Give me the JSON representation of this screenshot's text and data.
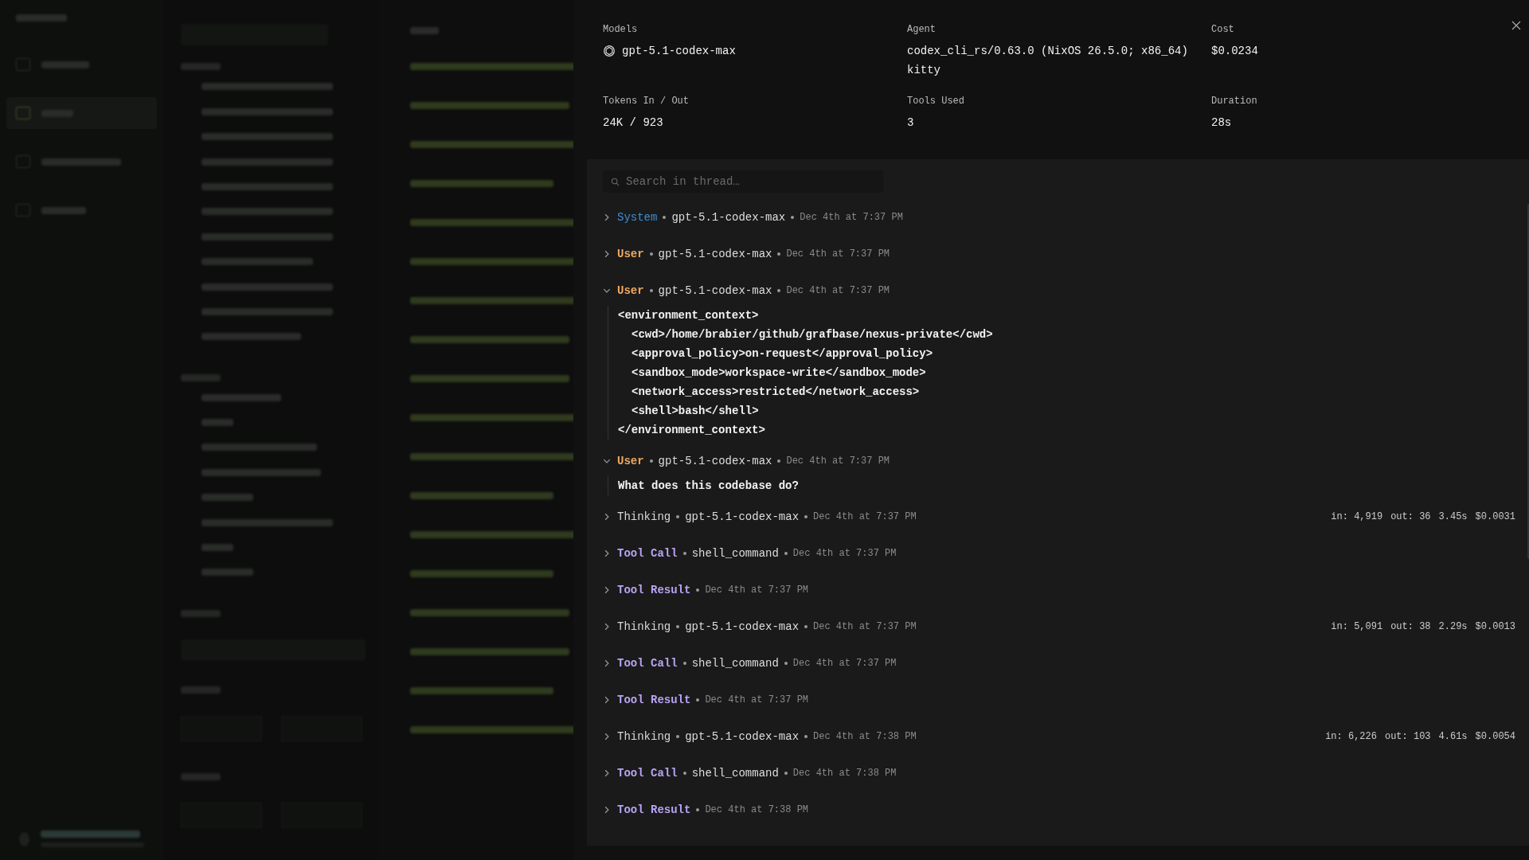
{
  "details": {
    "items": [
      {
        "kind": "model",
        "label": "Models",
        "lines": [
          "gpt-5.1-codex-max"
        ]
      },
      {
        "kind": "text",
        "label": "Agent",
        "lines": [
          "codex_cli_rs/0.63.0 (NixOS 26.5.0; x86_64)",
          "kitty"
        ]
      },
      {
        "kind": "text",
        "label": "Cost",
        "lines": [
          "$0.0234"
        ]
      },
      {
        "kind": "text",
        "label": "Tokens In / Out",
        "lines": [
          "24K / 923"
        ]
      },
      {
        "kind": "text",
        "label": "Tools Used",
        "lines": [
          "3"
        ]
      },
      {
        "kind": "text",
        "label": "Duration",
        "lines": [
          "28s"
        ]
      }
    ]
  },
  "thread": {
    "search_placeholder": "Search in thread…",
    "messages": [
      {
        "kind": "system",
        "role": "System",
        "source": "gpt-5.1-codex-max",
        "time": "Dec 4th at 7:37 PM",
        "expanded": false
      },
      {
        "kind": "user",
        "role": "User",
        "source": "gpt-5.1-codex-max",
        "time": "Dec 4th at 7:37 PM",
        "expanded": false
      },
      {
        "kind": "user",
        "role": "User",
        "source": "gpt-5.1-codex-max",
        "time": "Dec 4th at 7:37 PM",
        "expanded": true,
        "body": [
          {
            "text": "<environment_context>",
            "children": [
              {
                "text": "<cwd>/home/brabier/github/grafbase/nexus-private</cwd>"
              },
              {
                "text": "<approval_policy>on-request</approval_policy>"
              },
              {
                "text": "<sandbox_mode>workspace-write</sandbox_mode>"
              },
              {
                "text": "<network_access>restricted</network_access>"
              },
              {
                "text": "<shell>bash</shell>"
              }
            ]
          },
          {
            "text": "</environment_context>"
          }
        ]
      },
      {
        "kind": "user",
        "role": "User",
        "source": "gpt-5.1-codex-max",
        "time": "Dec 4th at 7:37 PM",
        "expanded": true,
        "body": [
          {
            "text": "What does this codebase do?"
          }
        ]
      },
      {
        "kind": "thinking",
        "role": "Thinking",
        "source": "gpt-5.1-codex-max",
        "time": "Dec 4th at 7:37 PM",
        "expanded": false,
        "stats": [
          "in: 4,919",
          "out: 36",
          "3.45s",
          "$0.0031"
        ]
      },
      {
        "kind": "tool",
        "role": "Tool Call",
        "source": "shell_command",
        "time": "Dec 4th at 7:37 PM",
        "expanded": false
      },
      {
        "kind": "tool",
        "role": "Tool Result",
        "time": "Dec 4th at 7:37 PM",
        "expanded": false
      },
      {
        "kind": "thinking",
        "role": "Thinking",
        "source": "gpt-5.1-codex-max",
        "time": "Dec 4th at 7:37 PM",
        "expanded": false,
        "stats": [
          "in: 5,091",
          "out: 38",
          "2.29s",
          "$0.0013"
        ]
      },
      {
        "kind": "tool",
        "role": "Tool Call",
        "source": "shell_command",
        "time": "Dec 4th at 7:37 PM",
        "expanded": false
      },
      {
        "kind": "tool",
        "role": "Tool Result",
        "time": "Dec 4th at 7:37 PM",
        "expanded": false
      },
      {
        "kind": "thinking",
        "role": "Thinking",
        "source": "gpt-5.1-codex-max",
        "time": "Dec 4th at 7:38 PM",
        "expanded": false,
        "stats": [
          "in: 6,226",
          "out: 103",
          "4.61s",
          "$0.0054"
        ]
      },
      {
        "kind": "tool",
        "role": "Tool Call",
        "source": "shell_command",
        "time": "Dec 4th at 7:38 PM",
        "expanded": false
      },
      {
        "kind": "tool",
        "role": "Tool Result",
        "time": "Dec 4th at 7:38 PM",
        "expanded": false
      }
    ]
  }
}
